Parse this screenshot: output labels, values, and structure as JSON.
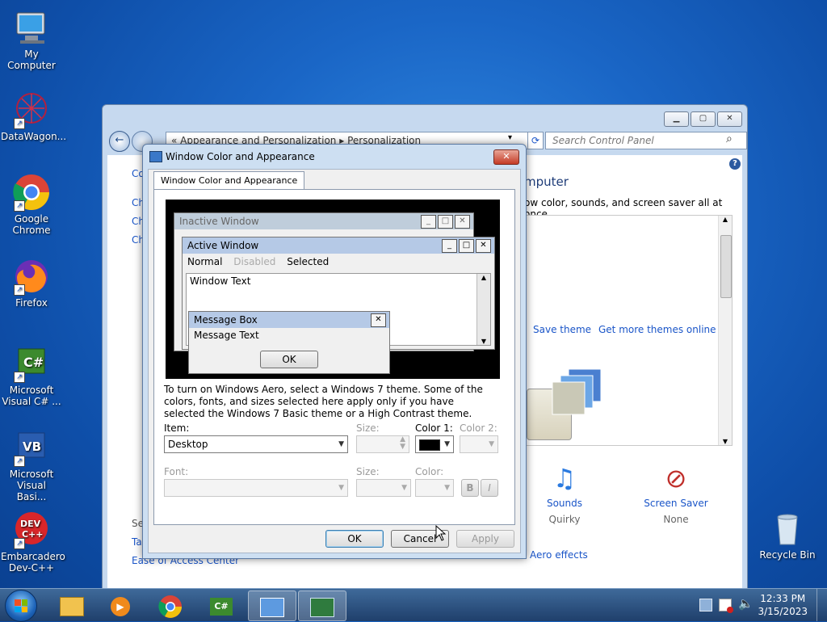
{
  "desktop": {
    "icons": [
      {
        "label": "My Computer"
      },
      {
        "label": "DataWagon..."
      },
      {
        "label": "Google Chrome"
      },
      {
        "label": "Firefox"
      },
      {
        "label": "Microsoft Visual C# ..."
      },
      {
        "label": "Microsoft Visual Basi..."
      },
      {
        "label": "Embarcadero Dev-C++"
      },
      {
        "label": "Recycle Bin"
      }
    ]
  },
  "control_panel": {
    "nav_back": "←",
    "address_prefix": "«",
    "address_crumb1": "Appearance and Personalization",
    "address_sep": "▸",
    "address_crumb2": "Personalization",
    "address_dropdown": "▾",
    "refresh": "⟳",
    "search_placeholder": "Search Control Panel",
    "search_icon": "⌕",
    "help_icon": "?",
    "left_items": [
      "Co",
      "Ch",
      "Ch",
      "Ch"
    ],
    "left_see_also": [
      "Se",
      "Ta",
      "Ease of Access Center"
    ],
    "heading_fragment": "mputer",
    "subheading_fragment": "ow color, sounds, and screen saver all at once.",
    "save_theme": "Save theme",
    "get_more_themes": "Get more themes online",
    "sounds_label": "Sounds",
    "sounds_value": "Quirky",
    "screensaver_label": "Screen Saver",
    "screensaver_value": "None",
    "aero_effects": "Aero effects",
    "caption": {
      "min": "▁",
      "max": "▢",
      "close": "✕"
    }
  },
  "dialog": {
    "title": "Window Color and Appearance",
    "close": "✕",
    "tab": "Window Color and Appearance",
    "preview": {
      "inactive_title": "Inactive Window",
      "active_title": "Active Window",
      "menu_normal": "Normal",
      "menu_disabled": "Disabled",
      "menu_selected": "Selected",
      "window_text": "Window Text",
      "msgbox_title": "Message Box",
      "msgbox_text": "Message Text",
      "msgbox_ok": "OK",
      "caption": {
        "min": "_",
        "max": "□",
        "close": "✕"
      }
    },
    "info": "To turn on Windows Aero, select a Windows 7 theme.  Some of the colors, fonts, and sizes selected here apply only if you have selected the Windows 7 Basic theme or a High Contrast theme.",
    "item_label": "Item:",
    "item_value": "Desktop",
    "size_label": "Size:",
    "color1_label": "Color 1:",
    "color2_label": "Color 2:",
    "color1_value": "#000000",
    "font_label": "Font:",
    "font_size_label": "Size:",
    "font_color_label": "Color:",
    "bold": "B",
    "italic": "I",
    "dropdown_icon": "▼",
    "ok": "OK",
    "cancel": "Cancel",
    "apply": "Apply"
  },
  "taskbar": {
    "start_icon": "start-orb",
    "items": [
      "explorer",
      "media-player",
      "chrome",
      "visual-csharp",
      "control-panel",
      "display-properties"
    ],
    "time": "12:33 PM",
    "date": "3/15/2023"
  }
}
